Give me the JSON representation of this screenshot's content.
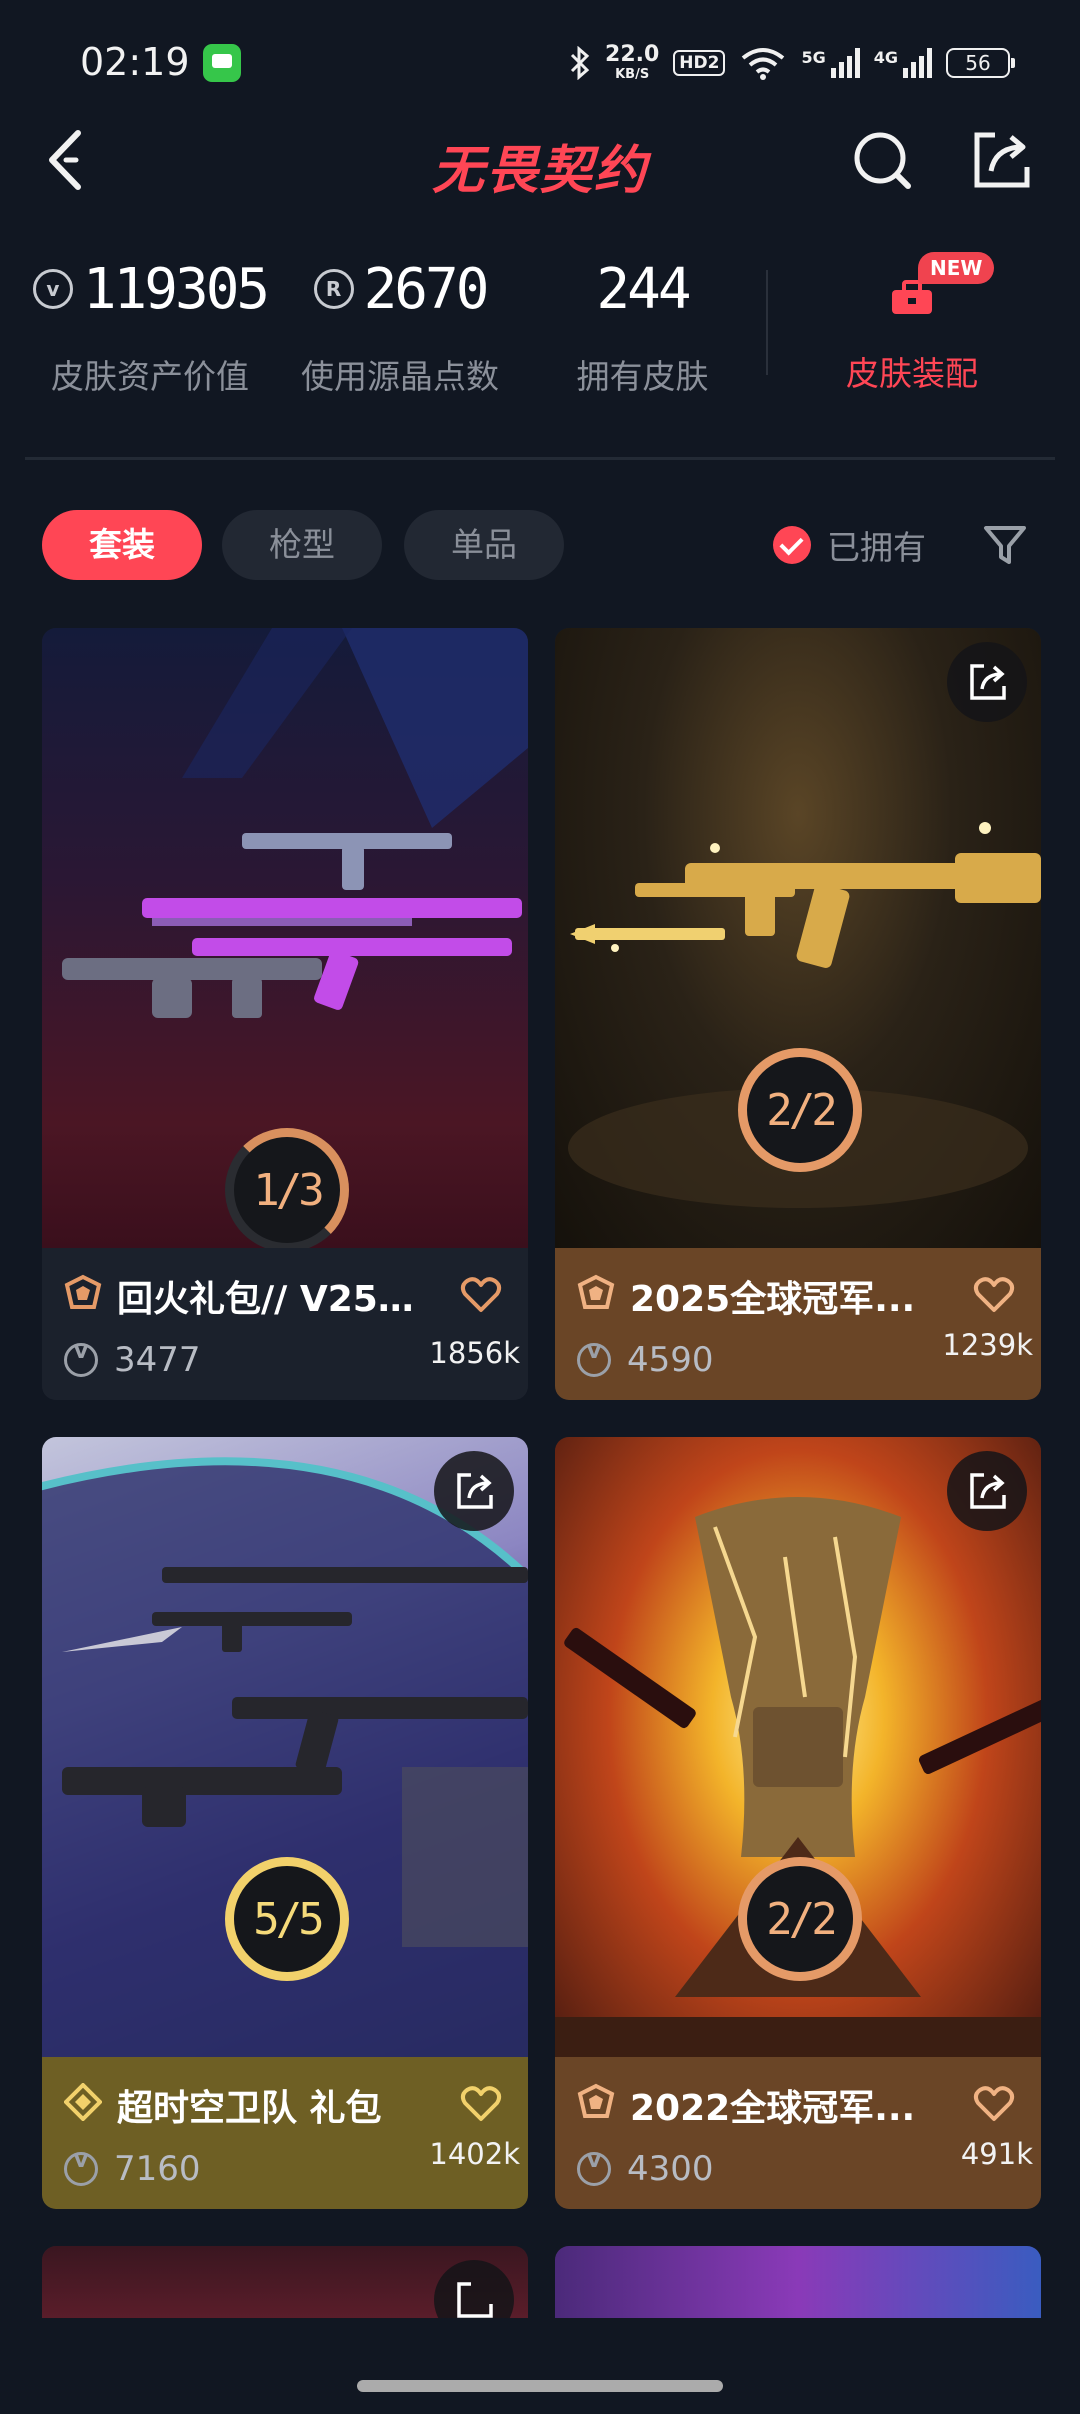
{
  "status_bar": {
    "time": "02:19",
    "net_speed_value": "22.0",
    "net_speed_unit": "KB/S",
    "hd_label": "HD2",
    "signal1_label": "5G",
    "signal2_label": "4G",
    "battery": "56"
  },
  "header": {
    "logo_text": "无畏契约"
  },
  "stats": {
    "asset_value": "119305",
    "asset_label": "皮肤资产价值",
    "radianite_value": "2670",
    "radianite_label": "使用源晶点数",
    "skins_value": "244",
    "skins_label": "拥有皮肤",
    "loadout_label": "皮肤装配",
    "new_badge": "NEW"
  },
  "filters": {
    "tabs": [
      "套装",
      "枪型",
      "单品"
    ],
    "owned_label": "已拥有"
  },
  "cards": [
    {
      "title": "回火礼包// V25...",
      "price": "3477",
      "likes": "1856k",
      "progress": "1/3",
      "progress_fraction": 0.333,
      "ring_color": "#d9905e",
      "info_bg": "#1b212c"
    },
    {
      "title": "2025全球冠军...",
      "price": "4590",
      "likes": "1239k",
      "progress": "2/2",
      "progress_fraction": 1.0,
      "ring_color": "#e59a67",
      "info_bg": "#6a4526"
    },
    {
      "title": "超时空卫队 礼包",
      "price": "7160",
      "likes": "1402k",
      "progress": "5/5",
      "progress_fraction": 1.0,
      "ring_color": "#f2d16b",
      "info_bg": "#6e5f24"
    },
    {
      "title": "2022全球冠军...",
      "price": "4300",
      "likes": "491k",
      "progress": "2/2",
      "progress_fraction": 1.0,
      "ring_color": "#e59a67",
      "info_bg": "#6a4526"
    }
  ]
}
